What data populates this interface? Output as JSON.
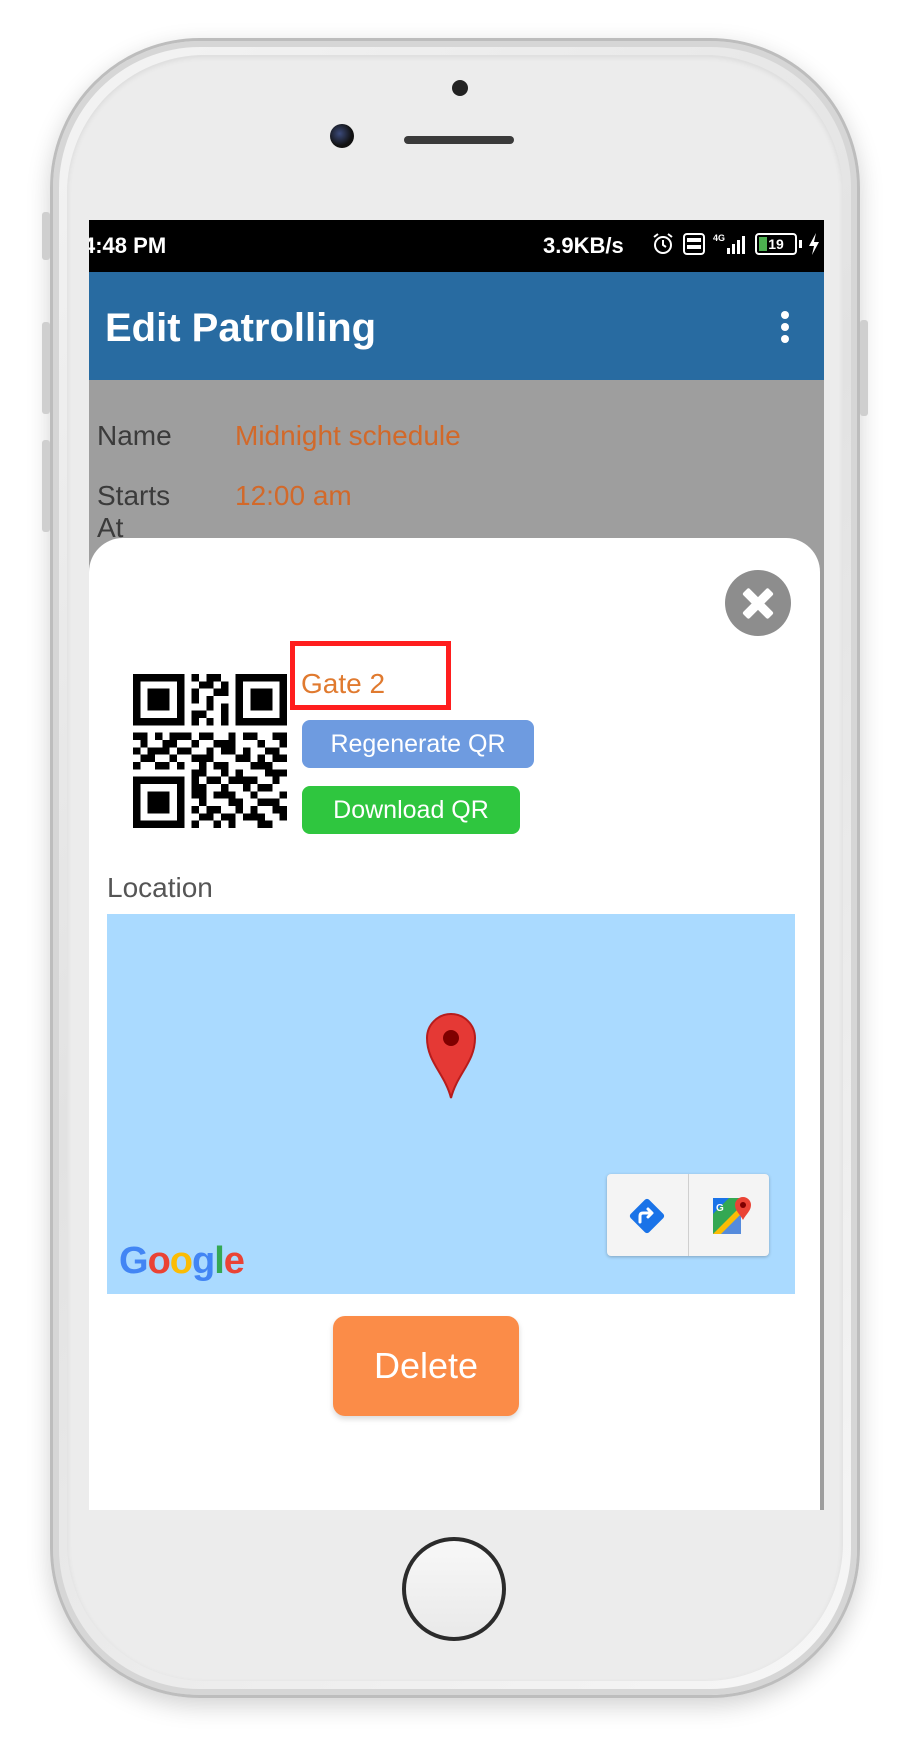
{
  "status_bar": {
    "time": "4:48 PM",
    "speed": "3.9KB/s",
    "battery": "19",
    "icons": [
      "alarm-icon",
      "volte-icon",
      "signal-4g-icon",
      "battery-icon",
      "charging-icon"
    ]
  },
  "app_bar": {
    "title": "Edit Patrolling",
    "menu_icon": "overflow-menu-icon"
  },
  "form": {
    "name_label": "Name",
    "name_value": "Midnight schedule",
    "starts_label": "Starts At",
    "starts_value": "12:00 am"
  },
  "dialog": {
    "close_icon": "close-icon",
    "checkpoint_name": "Gate 2",
    "regenerate_label": "Regenerate QR Code",
    "download_label": "Download QR Code",
    "location_label": "Location",
    "map_provider": "Google",
    "delete_label": "Delete"
  },
  "colors": {
    "app_bar": "#286ba1",
    "accent_orange": "#e07a2f",
    "regenerate_button": "#6e9be0",
    "download_button": "#2fc63f",
    "delete_button": "#fb8c48",
    "map_water": "#aadaff",
    "highlight_box": "#ff1e1e"
  }
}
